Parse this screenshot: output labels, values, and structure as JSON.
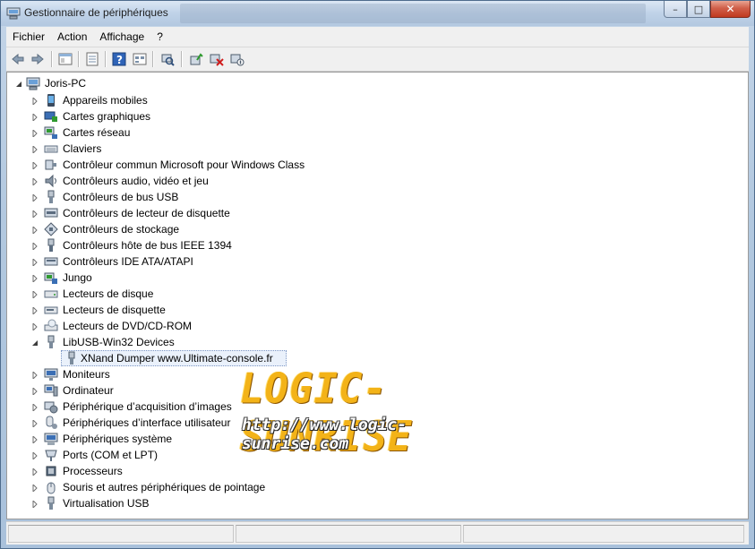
{
  "window": {
    "title": "Gestionnaire de périphériques"
  },
  "menu": [
    "Fichier",
    "Action",
    "Affichage",
    "?"
  ],
  "toolbar": {
    "buttons": [
      {
        "name": "back-icon"
      },
      {
        "name": "forward-icon"
      },
      {
        "name": "show-hide-tree-icon"
      },
      {
        "name": "properties-icon"
      },
      {
        "name": "help-icon"
      },
      {
        "name": "view-icon"
      },
      {
        "name": "scan-hardware-icon"
      },
      {
        "name": "update-driver-icon"
      },
      {
        "name": "uninstall-icon"
      },
      {
        "name": "disable-icon"
      }
    ]
  },
  "tree": {
    "root": "Joris-PC",
    "categories": [
      {
        "label": "Appareils mobiles",
        "icon": "mobile-device-icon"
      },
      {
        "label": "Cartes graphiques",
        "icon": "display-adapter-icon"
      },
      {
        "label": "Cartes réseau",
        "icon": "network-adapter-icon"
      },
      {
        "label": "Claviers",
        "icon": "keyboard-icon"
      },
      {
        "label": "Contrôleur commun Microsoft pour Windows Class",
        "icon": "usb-controller-icon"
      },
      {
        "label": "Contrôleurs audio, vidéo et jeu",
        "icon": "speaker-icon"
      },
      {
        "label": "Contrôleurs de bus USB",
        "icon": "usb-plug-icon"
      },
      {
        "label": "Contrôleurs de lecteur de disquette",
        "icon": "floppy-controller-icon"
      },
      {
        "label": "Contrôleurs de stockage",
        "icon": "storage-controller-icon"
      },
      {
        "label": "Contrôleurs hôte de bus IEEE 1394",
        "icon": "firewire-icon"
      },
      {
        "label": "Contrôleurs IDE ATA/ATAPI",
        "icon": "ide-controller-icon"
      },
      {
        "label": "Jungo",
        "icon": "jungo-icon"
      },
      {
        "label": "Lecteurs de disque",
        "icon": "disk-drive-icon"
      },
      {
        "label": "Lecteurs de disquette",
        "icon": "floppy-drive-icon"
      },
      {
        "label": "Lecteurs de DVD/CD-ROM",
        "icon": "dvd-drive-icon"
      },
      {
        "label": "LibUSB-Win32 Devices",
        "icon": "libusb-icon",
        "expanded": true,
        "children": [
          {
            "label": "XNand Dumper www.Ultimate-console.fr",
            "icon": "usb-device-icon",
            "selected": true
          }
        ]
      },
      {
        "label": "Moniteurs",
        "icon": "monitor-icon"
      },
      {
        "label": "Ordinateur",
        "icon": "computer-icon"
      },
      {
        "label": "Périphérique d’acquisition d’images",
        "icon": "camera-icon"
      },
      {
        "label": "Périphériques d’interface utilisateur",
        "icon": "hid-icon"
      },
      {
        "label": "Périphériques système",
        "icon": "system-device-icon"
      },
      {
        "label": "Ports (COM et LPT)",
        "icon": "port-icon"
      },
      {
        "label": "Processeurs",
        "icon": "processor-icon"
      },
      {
        "label": "Souris et autres périphériques de pointage",
        "icon": "mouse-icon"
      },
      {
        "label": "Virtualisation USB",
        "icon": "usb-virtual-icon"
      }
    ]
  },
  "watermark": {
    "title": "LOGIC-SUNRISE",
    "url": "http://www.logic-sunrise.com"
  },
  "colors": {
    "selection": "#eaf1fb",
    "watermark_gold": "#f3b318"
  }
}
